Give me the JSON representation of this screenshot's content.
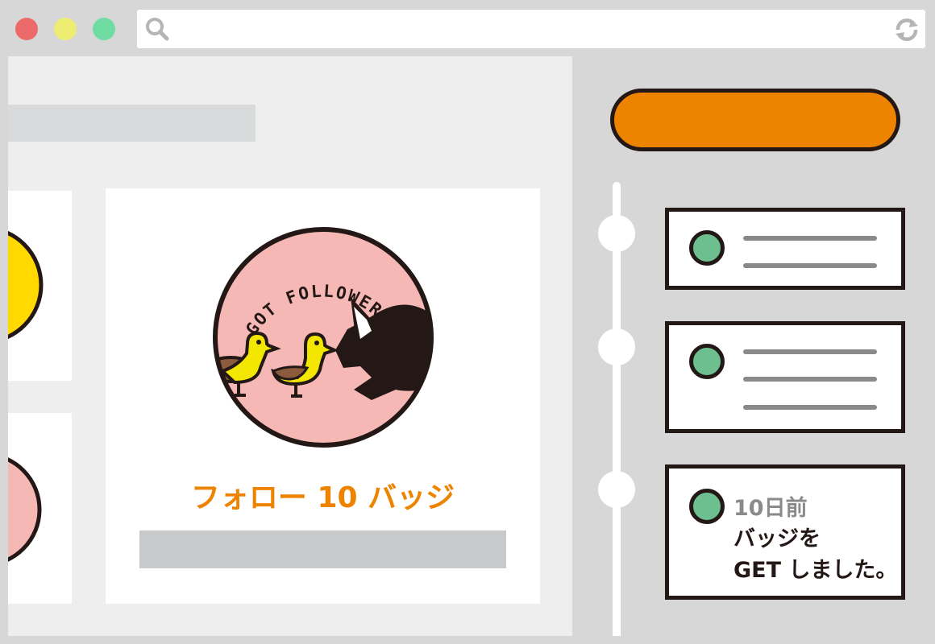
{
  "window": {
    "controls": [
      {
        "name": "close",
        "color": "#ec6a6a"
      },
      {
        "name": "minimize",
        "color": "#eded71"
      },
      {
        "name": "maximize",
        "color": "#6fdca4"
      }
    ],
    "url_bar": {
      "value": "",
      "search_icon": "search-icon",
      "refresh_icon": "refresh-icon"
    }
  },
  "badge_card": {
    "emblem_text": "GOT FOLLOWERS!",
    "title": "フォロー 10 バッジ",
    "colors": {
      "badge_bg": "#f5b8b5",
      "accent": "#ee8300",
      "duck": "#f3e600"
    }
  },
  "activity": {
    "items": [
      {
        "type": "placeholder",
        "lines": 2
      },
      {
        "type": "placeholder",
        "lines": 3
      },
      {
        "type": "message",
        "time": "10日前",
        "message": "バッジを\nGET しました。"
      }
    ]
  }
}
